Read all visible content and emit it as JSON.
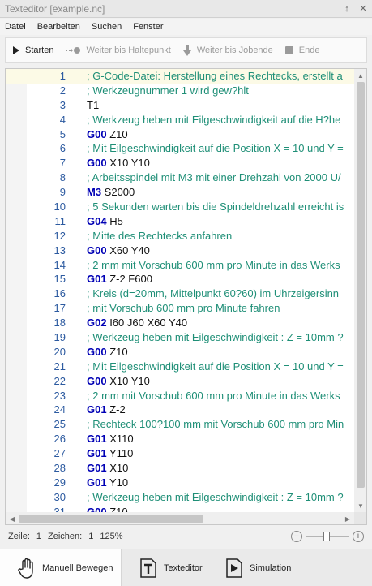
{
  "window": {
    "title": "Texteditor [example.nc]",
    "pin_glyph": "↕",
    "close_glyph": "✕"
  },
  "menu": [
    "Datei",
    "Bearbeiten",
    "Suchen",
    "Fenster"
  ],
  "toolbar": {
    "start": "Starten",
    "to_breakpoint": "Weiter bis Haltepunkt",
    "to_job_end": "Weiter bis Jobende",
    "end": "Ende"
  },
  "editor": {
    "lines": [
      {
        "n": "1",
        "text": "; G-Code-Datei: Herstellung eines Rechtecks, erstellt a",
        "type": "comment"
      },
      {
        "n": "2",
        "text": "; Werkzeugnummer 1 wird gew?hlt",
        "type": "comment"
      },
      {
        "n": "3",
        "text": "T1",
        "type": "plain"
      },
      {
        "n": "4",
        "text": "; Werkzeug heben mit Eilgeschwindigkeit auf die H?he",
        "type": "comment"
      },
      {
        "n": "5",
        "kw": "G00",
        "text": " Z10",
        "type": "code"
      },
      {
        "n": "6",
        "text": "; Mit Eilgeschwindigkeit auf die Position X = 10 und Y =",
        "type": "comment"
      },
      {
        "n": "7",
        "kw": "G00",
        "text": " X10 Y10",
        "type": "code"
      },
      {
        "n": "8",
        "text": "; Arbeitsspindel mit M3 mit einer Drehzahl von 2000 U/",
        "type": "comment"
      },
      {
        "n": "9",
        "kw": "M3",
        "text": " S2000",
        "type": "code"
      },
      {
        "n": "10",
        "text": "; 5 Sekunden warten bis die Spindeldrehzahl erreicht is",
        "type": "comment"
      },
      {
        "n": "11",
        "kw": "G04",
        "text": " H5",
        "type": "code"
      },
      {
        "n": "12",
        "text": "; Mitte des Rechtecks anfahren",
        "type": "comment"
      },
      {
        "n": "13",
        "kw": "G00",
        "text": " X60 Y40",
        "type": "code"
      },
      {
        "n": "14",
        "text": "; 2 mm mit Vorschub 600 mm pro Minute in das Werks",
        "type": "comment"
      },
      {
        "n": "15",
        "kw": "G01",
        "text": " Z-2 F600",
        "type": "code"
      },
      {
        "n": "16",
        "text": "; Kreis (d=20mm, Mittelpunkt 60?60) im Uhrzeigersinn",
        "type": "comment"
      },
      {
        "n": "17",
        "text": "; mit Vorschub 600 mm pro Minute fahren",
        "type": "comment"
      },
      {
        "n": "18",
        "kw": "G02",
        "text": " I60 J60 X60 Y40",
        "type": "code"
      },
      {
        "n": "19",
        "text": "; Werkzeug heben mit Eilgeschwindigkeit : Z = 10mm ?",
        "type": "comment"
      },
      {
        "n": "20",
        "kw": "G00",
        "text": " Z10",
        "type": "code"
      },
      {
        "n": "21",
        "text": "; Mit Eilgeschwindigkeit auf die Position X = 10 und Y =",
        "type": "comment"
      },
      {
        "n": "22",
        "kw": "G00",
        "text": " X10 Y10",
        "type": "code"
      },
      {
        "n": "23",
        "text": "; 2 mm mit Vorschub 600 mm pro Minute in das Werks",
        "type": "comment"
      },
      {
        "n": "24",
        "kw": "G01",
        "text": " Z-2",
        "type": "code"
      },
      {
        "n": "25",
        "text": "; Rechteck 100?100 mm mit Vorschub 600 mm pro Min",
        "type": "comment"
      },
      {
        "n": "26",
        "kw": "G01",
        "text": " X110",
        "type": "code"
      },
      {
        "n": "27",
        "kw": "G01",
        "text": " Y110",
        "type": "code"
      },
      {
        "n": "28",
        "kw": "G01",
        "text": " X10",
        "type": "code"
      },
      {
        "n": "29",
        "kw": "G01",
        "text": " Y10",
        "type": "code"
      },
      {
        "n": "30",
        "text": "; Werkzeug heben mit Eilgeschwindigkeit : Z = 10mm ?",
        "type": "comment"
      },
      {
        "n": "31",
        "kw": "G00",
        "text": " Z10",
        "type": "code"
      }
    ]
  },
  "status": {
    "line_label": "Zeile:",
    "line_value": "1",
    "char_label": "Zeichen:",
    "char_value": "1",
    "zoom": "125%"
  },
  "tabs": [
    {
      "label": "Manuell Bewegen",
      "icon": "hand-icon",
      "active": true
    },
    {
      "label": "Texteditor",
      "icon": "text-editor-icon",
      "active": false
    },
    {
      "label": "Simulation",
      "icon": "play-file-icon",
      "active": false
    }
  ],
  "colors": {
    "comment": "#1f8f77",
    "keyword": "#0000b5",
    "line_number": "#2c5aa0",
    "current_line": "#fcfae6"
  }
}
